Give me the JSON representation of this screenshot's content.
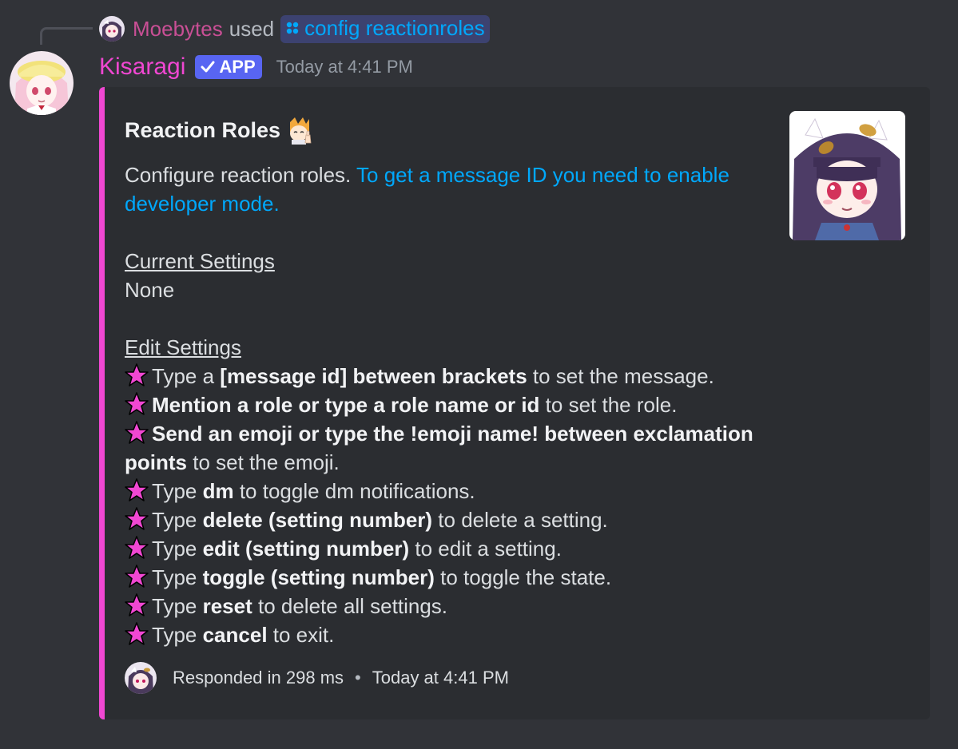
{
  "reply": {
    "username": "Moebytes",
    "used_text": "used",
    "command": "config reactionroles",
    "command_icon": "slash-command-icon"
  },
  "message": {
    "author": "Kisaragi",
    "badge": "APP",
    "timestamp": "Today at 4:41 PM",
    "author_color": "#f047d2"
  },
  "embed": {
    "accent_color": "#f047d2",
    "title": "Reaction Roles",
    "description": {
      "intro": "Configure reaction roles.",
      "link": "To get a message ID you need to enable developer mode."
    },
    "current_settings": {
      "heading": "Current Settings",
      "value": "None"
    },
    "edit_settings": {
      "heading": "Edit Settings",
      "items": [
        {
          "pre": "Type a ",
          "bold": "[message id] between brackets",
          "post": " to set the message."
        },
        {
          "pre": "",
          "bold": "Mention a role or type a role name or id",
          "post": " to set the role."
        },
        {
          "pre": "",
          "bold": "Send an emoji or type the !emoji name! between exclamation points",
          "post": " to set the emoji."
        },
        {
          "pre": "Type ",
          "bold": "dm",
          "post": " to toggle dm notifications."
        },
        {
          "pre": "Type ",
          "bold": "delete (setting number)",
          "post": " to delete a setting."
        },
        {
          "pre": "Type ",
          "bold": "edit (setting number)",
          "post": " to edit a setting."
        },
        {
          "pre": "Type ",
          "bold": "toggle (setting number)",
          "post": " to toggle the state."
        },
        {
          "pre": "Type ",
          "bold": "reset",
          "post": " to delete all settings."
        },
        {
          "pre": "Type ",
          "bold": "cancel",
          "post": " to exit."
        }
      ]
    },
    "footer": {
      "text": "Responded in 298 ms",
      "separator": "•",
      "timestamp": "Today at 4:41 PM"
    }
  }
}
